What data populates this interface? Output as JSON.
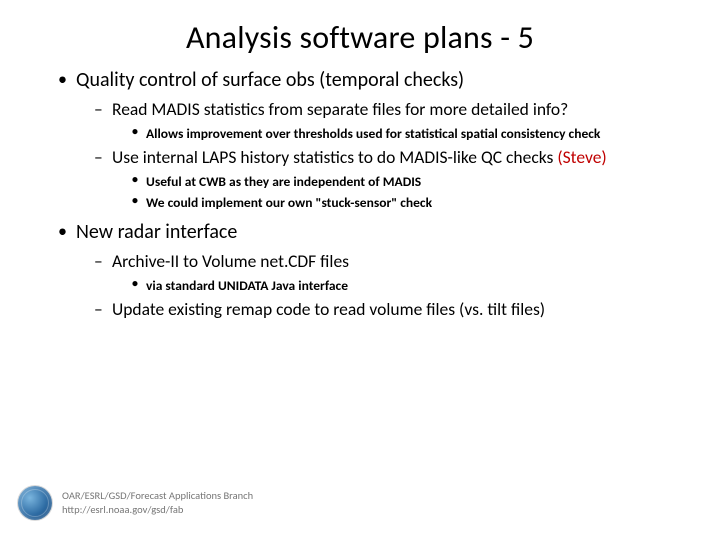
{
  "title": "Analysis software plans - 5",
  "bullets": {
    "b1": {
      "text": "Quality control of surface obs (temporal checks)",
      "sub": {
        "s1": {
          "text": "Read MADIS statistics from separate files for more detailed info?",
          "sub": {
            "t1": "Allows improvement over thresholds used for statistical spatial consistency check"
          }
        },
        "s2": {
          "text": "Use internal LAPS history statistics to do MADIS-like QC checks ",
          "owner": "(Steve)",
          "sub": {
            "t1": "Useful at CWB as they are independent of MADIS",
            "t2": "We could implement our own \"stuck-sensor\" check"
          }
        }
      }
    },
    "b2": {
      "text": "New radar interface",
      "sub": {
        "s1": {
          "text": "Archive-II to Volume net.CDF files",
          "sub": {
            "t1": "via standard UNIDATA Java interface"
          }
        },
        "s2": {
          "text": "Update existing remap code to read volume files (vs. tilt files)"
        }
      }
    }
  },
  "footer": {
    "line1": "OAR/ESRL/GSD/Forecast Applications Branch",
    "line2": "http://esrl.noaa.gov/gsd/fab"
  }
}
